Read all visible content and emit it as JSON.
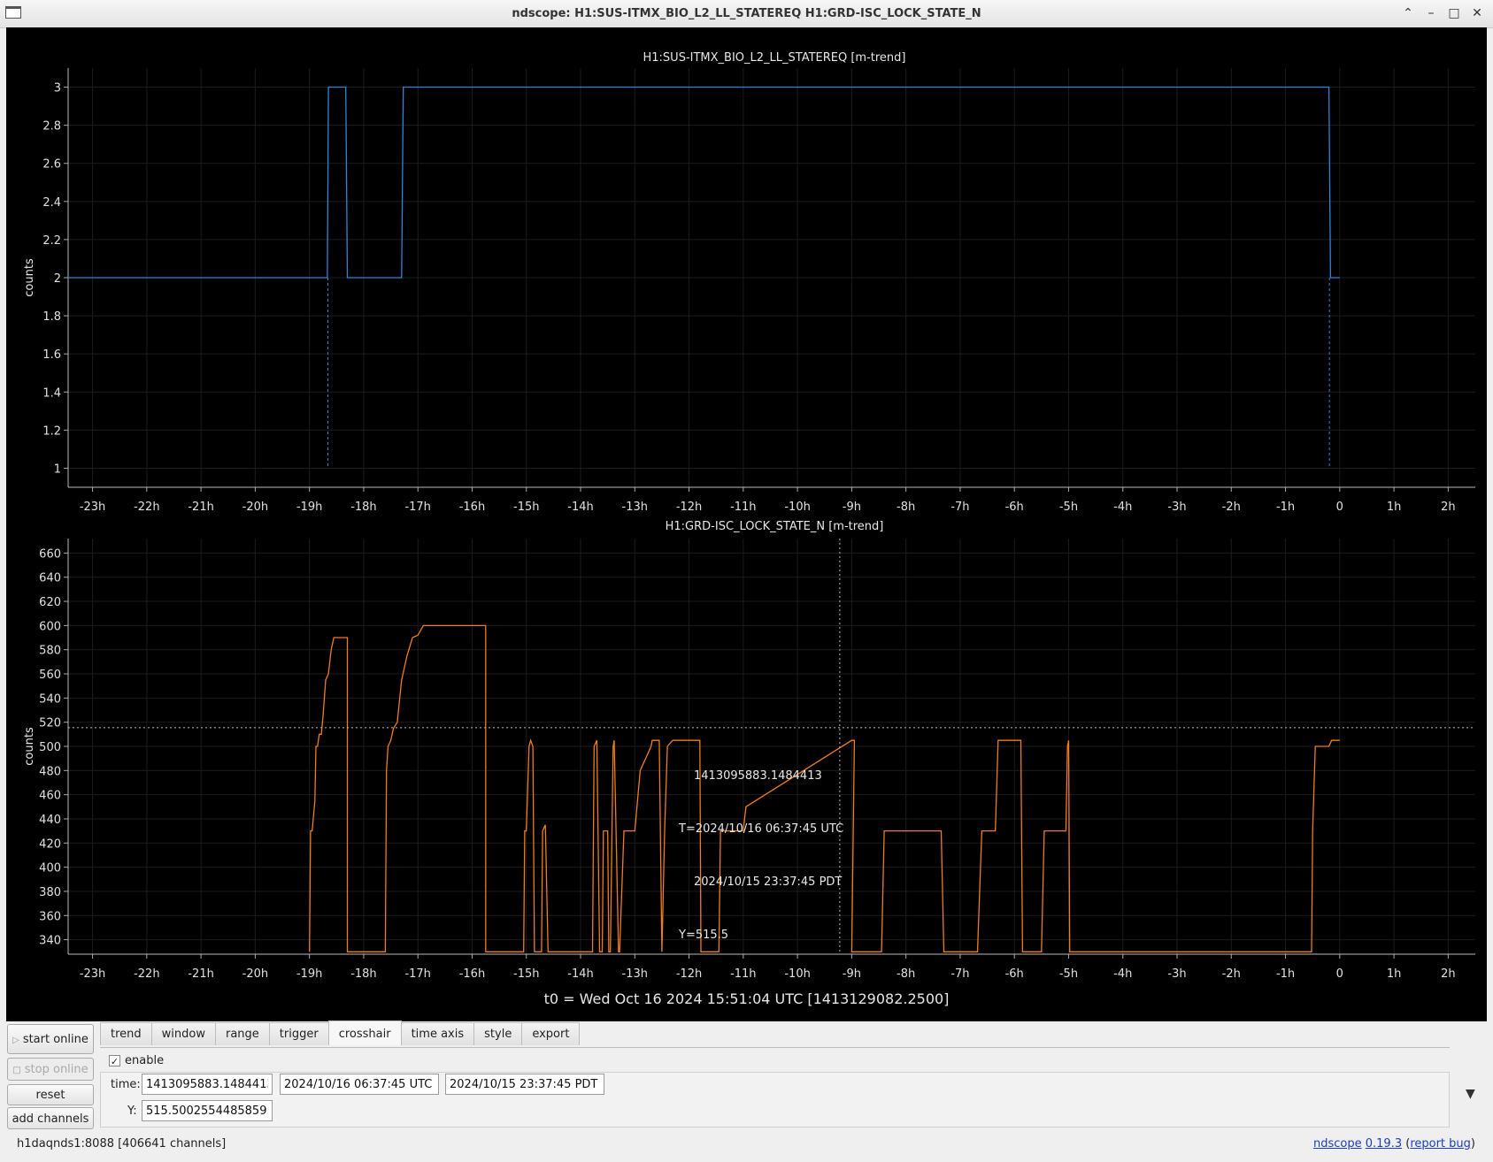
{
  "window": {
    "title": "ndscope: H1:SUS-ITMX_BIO_L2_LL_STATEREQ H1:GRD-ISC_LOCK_STATE_N"
  },
  "plots": [
    {
      "title": "H1:SUS-ITMX_BIO_L2_LL_STATEREQ [m-trend]",
      "ylabel": "counts",
      "color": "#2f86d6",
      "yticks": [
        1,
        1.2,
        1.4,
        1.6,
        1.8,
        2,
        2.2,
        2.4,
        2.6,
        2.8,
        3
      ],
      "ylim": [
        0.9,
        3.1
      ]
    },
    {
      "title": "H1:GRD-ISC_LOCK_STATE_N [m-trend]",
      "ylabel": "counts",
      "color": "#ee7d1b",
      "yticks": [
        340,
        360,
        380,
        400,
        420,
        440,
        460,
        480,
        500,
        520,
        540,
        560,
        580,
        600,
        620,
        640,
        660
      ],
      "ylim": [
        328,
        672
      ]
    }
  ],
  "xticks": [
    "-23h",
    "-22h",
    "-21h",
    "-20h",
    "-19h",
    "-18h",
    "-17h",
    "-16h",
    "-15h",
    "-14h",
    "-13h",
    "-12h",
    "-11h",
    "-10h",
    "-9h",
    "-8h",
    "-7h",
    "-6h",
    "-5h",
    "-4h",
    "-3h",
    "-2h",
    "-1h",
    "0",
    "1h",
    "2h"
  ],
  "chart_data": [
    {
      "type": "line",
      "title": "H1:SUS-ITMX_BIO_L2_LL_STATEREQ [m-trend]",
      "xlabel": "",
      "ylabel": "counts",
      "xlim": [
        -23.45,
        2.5
      ],
      "ylim": [
        0.9,
        3.1
      ],
      "grid": true,
      "series": [
        {
          "name": "H1:SUS-ITMX_BIO_L2_LL_STATEREQ [m-trend]",
          "x": [
            -23.45,
            -18.67,
            -18.65,
            -18.62,
            -18.33,
            -18.3,
            -17.3,
            -17.27,
            -0.2,
            -0.17,
            0
          ],
          "y": [
            2,
            2,
            3,
            3,
            3,
            2,
            2,
            3,
            3,
            2,
            2
          ]
        }
      ]
    },
    {
      "type": "line",
      "title": "H1:GRD-ISC_LOCK_STATE_N [m-trend]",
      "xlabel": "",
      "ylabel": "counts",
      "xlim": [
        -23.45,
        2.5
      ],
      "ylim": [
        328,
        672
      ],
      "grid": true,
      "series": [
        {
          "name": "H1:GRD-ISC_LOCK_STATE_N [m-trend]",
          "x": [
            -19.0,
            -18.98,
            -18.95,
            -18.9,
            -18.88,
            -18.85,
            -18.82,
            -18.78,
            -18.75,
            -18.7,
            -18.65,
            -18.6,
            -18.55,
            -18.5,
            -18.48,
            -18.4,
            -18.3,
            -18.3,
            -17.6,
            -17.58,
            -17.55,
            -17.5,
            -17.45,
            -17.38,
            -17.3,
            -17.2,
            -17.1,
            -17.0,
            -16.9,
            -16.85,
            -16.78,
            -16.75,
            -15.75,
            -15.75,
            -15.05,
            -15.03,
            -15.0,
            -14.95,
            -14.92,
            -14.88,
            -14.85,
            -14.72,
            -14.7,
            -14.65,
            -14.6,
            -13.78,
            -13.75,
            -13.7,
            -13.65,
            -13.6,
            -13.58,
            -13.5,
            -13.48,
            -13.45,
            -13.4,
            -13.38,
            -13.3,
            -13.28,
            -13.2,
            -13.0,
            -12.9,
            -12.7,
            -12.68,
            -12.6,
            -12.55,
            -12.5,
            -12.45,
            -12.4,
            -12.3,
            -11.8,
            -11.78,
            -11.75,
            -11.45,
            -11.42,
            -11.4,
            -11.0,
            -10.95,
            -9.0,
            -8.95,
            -9.0,
            -8.45,
            -8.4,
            -7.35,
            -7.3,
            -6.68,
            -6.6,
            -6.35,
            -6.3,
            -6.25,
            -6.2,
            -5.88,
            -5.85,
            -5.5,
            -5.45,
            -5.05,
            -5.02,
            -5.0,
            -4.98,
            -0.52,
            -0.5,
            -0.45,
            -0.4,
            -0.2,
            -0.15,
            0
          ],
          "y": [
            330,
            430,
            430,
            455,
            500,
            500,
            510,
            510,
            525,
            555,
            560,
            580,
            590,
            590,
            590,
            590,
            590,
            330,
            330,
            480,
            500,
            505,
            515,
            520,
            555,
            575,
            590,
            592,
            600,
            600,
            600,
            600,
            600,
            330,
            330,
            430,
            430,
            500,
            505,
            500,
            330,
            330,
            430,
            435,
            330,
            330,
            500,
            505,
            330,
            330,
            430,
            430,
            330,
            330,
            500,
            505,
            330,
            330,
            430,
            430,
            480,
            500,
            505,
            505,
            505,
            330,
            430,
            500,
            505,
            505,
            330,
            330,
            330,
            430,
            430,
            430,
            450,
            505,
            505,
            330,
            330,
            430,
            430,
            330,
            330,
            430,
            430,
            505,
            505,
            505,
            505,
            330,
            330,
            430,
            430,
            500,
            505,
            330,
            330,
            430,
            500,
            500,
            500,
            505,
            505
          ]
        }
      ]
    }
  ],
  "crosshair": {
    "gps": "1413095883.1484413",
    "t_label": "T=",
    "utc": "2024/10/16 06:37:45 UTC",
    "pdt": "2024/10/15 23:37:45 PDT",
    "y_label": "Y=",
    "y": "515.5",
    "x_value": -9.22,
    "y_value": 515.5
  },
  "t0_label": "t0 = Wed Oct 16 2024 15:51:04 UTC [1413129082.2500]",
  "controls": {
    "start_online": "start online",
    "stop_online": "stop online",
    "reset": "reset",
    "add_channels": "add channels"
  },
  "tabs": [
    "trend",
    "window",
    "range",
    "trigger",
    "crosshair",
    "time axis",
    "style",
    "export"
  ],
  "active_tab": "crosshair",
  "crosshair_panel": {
    "enable_label": "enable",
    "time_label": "time:",
    "y_label": "Y:",
    "time_gps": "1413095883.1484413",
    "time_utc": "2024/10/16 06:37:45 UTC",
    "time_pdt": "2024/10/15 23:37:45 PDT",
    "y_value": "515.5002554485859"
  },
  "status": {
    "server": "h1daqnds1:8088  [406641 channels]",
    "app_name": "ndscope",
    "version": "0.19.3",
    "report_bug": "report bug"
  }
}
